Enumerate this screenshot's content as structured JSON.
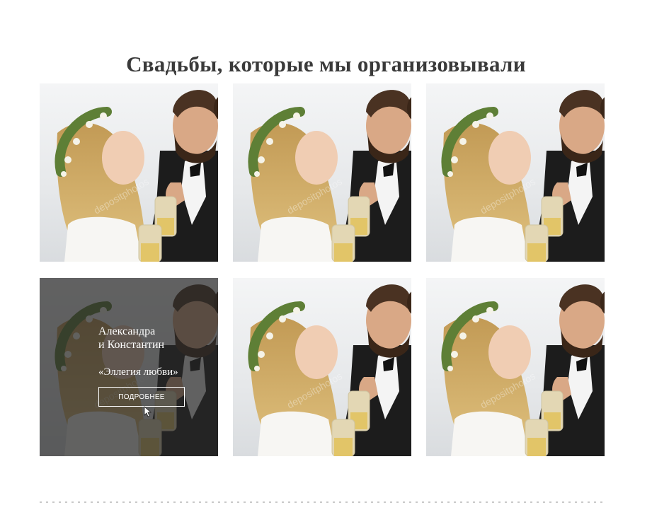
{
  "page": {
    "title": "Свадьбы, которые мы организовывали"
  },
  "gallery": {
    "items": [
      {
        "id": 1
      },
      {
        "id": 2
      },
      {
        "id": 3
      },
      {
        "id": 4,
        "hover": true,
        "names": "Александра\nи Константин",
        "event": "«Эллегия любви»",
        "button": "ПОДРОБНЕЕ"
      },
      {
        "id": 5
      },
      {
        "id": 6
      }
    ]
  },
  "colors": {
    "title": "#3a3a3a",
    "overlay": "rgba(40,40,40,0.72)",
    "suit": "#1c1c1c",
    "hair": "#caa463",
    "wreath": "#5e7f36"
  },
  "icons": {
    "cursor": "mouse-pointer-icon"
  }
}
